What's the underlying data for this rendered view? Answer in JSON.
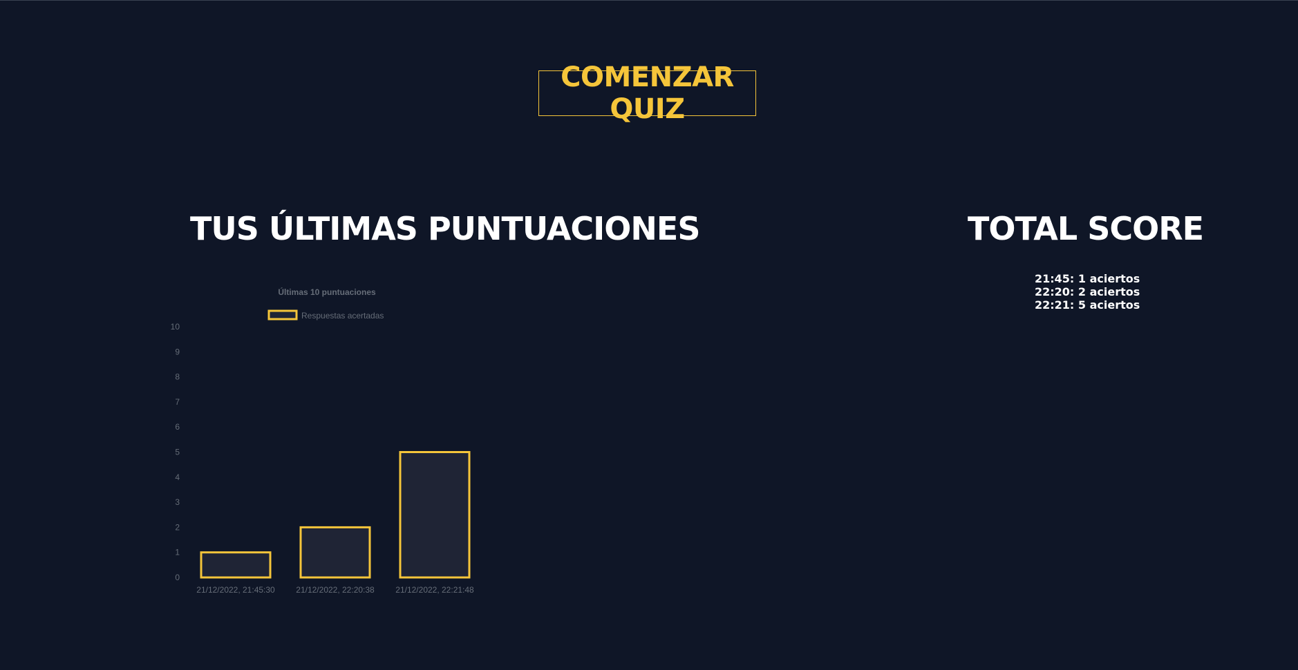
{
  "start_button": {
    "label": "COMENZAR QUIZ"
  },
  "scores_section": {
    "title": "TUS ÚLTIMAS PUNTUACIONES"
  },
  "total_section": {
    "title": "TOTAL SCORE",
    "entries": [
      "21:45: 1 aciertos",
      "22:20: 2 aciertos",
      "22:21: 5 aciertos"
    ]
  },
  "colors": {
    "background": "#0f1627",
    "accent": "#f5c53a",
    "bar_fill": "#1f2435",
    "muted_text": "#666d78"
  },
  "chart_data": {
    "type": "bar",
    "title": "Últimas 10 puntuaciones",
    "categories": [
      "21/12/2022, 21:45:30",
      "21/12/2022, 22:20:38",
      "21/12/2022, 22:21:48"
    ],
    "series": [
      {
        "name": "Respuestas acertadas",
        "values": [
          1,
          2,
          5
        ]
      }
    ],
    "ylim": [
      0,
      10
    ],
    "yticks": [
      0,
      1,
      2,
      3,
      4,
      5,
      6,
      7,
      8,
      9,
      10
    ],
    "legend_position": "top",
    "grid": false
  }
}
